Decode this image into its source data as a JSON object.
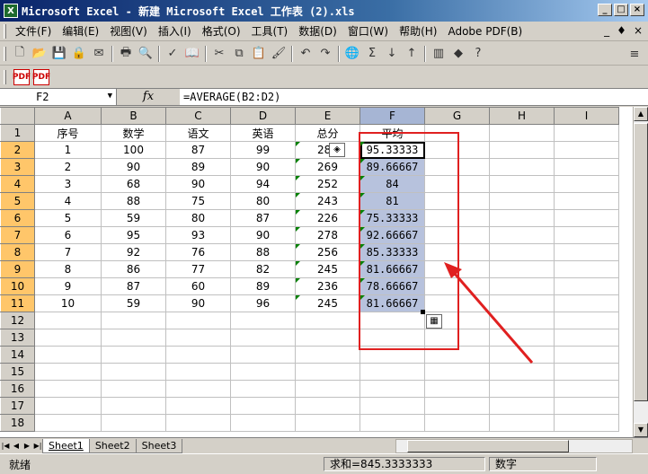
{
  "window": {
    "title": "Microsoft Excel - 新建 Microsoft Excel 工作表 (2).xls"
  },
  "menubar": {
    "items": [
      "文件(F)",
      "编辑(E)",
      "视图(V)",
      "插入(I)",
      "格式(O)",
      "工具(T)",
      "数据(D)",
      "窗口(W)",
      "帮助(H)",
      "Adobe PDF(B)"
    ],
    "right": [
      "_",
      "♦",
      "×"
    ]
  },
  "formula_bar": {
    "name_box": "F2",
    "fx": "fx",
    "formula": "=AVERAGE(B2:D2)"
  },
  "columns": [
    "A",
    "B",
    "C",
    "D",
    "E",
    "F",
    "G",
    "H",
    "I"
  ],
  "rows": [
    {
      "n": "1",
      "cells": [
        "序号",
        "数学",
        "语文",
        "英语",
        "总分",
        "平均"
      ]
    },
    {
      "n": "2",
      "cells": [
        "1",
        "100",
        "87",
        "99",
        "286",
        "95.33333"
      ]
    },
    {
      "n": "3",
      "cells": [
        "2",
        "90",
        "89",
        "90",
        "269",
        "89.66667"
      ]
    },
    {
      "n": "4",
      "cells": [
        "3",
        "68",
        "90",
        "94",
        "252",
        "84"
      ]
    },
    {
      "n": "5",
      "cells": [
        "4",
        "88",
        "75",
        "80",
        "243",
        "81"
      ]
    },
    {
      "n": "6",
      "cells": [
        "5",
        "59",
        "80",
        "87",
        "226",
        "75.33333"
      ]
    },
    {
      "n": "7",
      "cells": [
        "6",
        "95",
        "93",
        "90",
        "278",
        "92.66667"
      ]
    },
    {
      "n": "8",
      "cells": [
        "7",
        "92",
        "76",
        "88",
        "256",
        "85.33333"
      ]
    },
    {
      "n": "9",
      "cells": [
        "8",
        "86",
        "77",
        "82",
        "245",
        "81.66667"
      ]
    },
    {
      "n": "10",
      "cells": [
        "9",
        "87",
        "60",
        "89",
        "236",
        "78.66667"
      ]
    },
    {
      "n": "11",
      "cells": [
        "10",
        "59",
        "90",
        "96",
        "245",
        "81.66667"
      ]
    },
    {
      "n": "12",
      "cells": []
    },
    {
      "n": "13",
      "cells": []
    },
    {
      "n": "14",
      "cells": []
    },
    {
      "n": "15",
      "cells": []
    },
    {
      "n": "16",
      "cells": []
    },
    {
      "n": "17",
      "cells": []
    },
    {
      "n": "18",
      "cells": []
    }
  ],
  "sheets": {
    "tabs": [
      "Sheet1",
      "Sheet2",
      "Sheet3"
    ],
    "active": "Sheet1"
  },
  "status": {
    "ready": "就绪",
    "sum": "求和=845.3333333",
    "mode": "数字"
  },
  "colors": {
    "selection": "#b7c2dd",
    "annotation": "#e02020",
    "title_bar": "#0a246a"
  }
}
